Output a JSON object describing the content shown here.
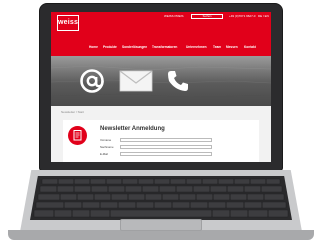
{
  "site": {
    "logo_text": "weiss",
    "top_links": [
      "WEISS PREIS",
      "+49 (0)7071 9627-0",
      "DE / EN"
    ],
    "search_label": "Suchen"
  },
  "nav": {
    "items": [
      "Home",
      "Produkte",
      "Sonderlösungen",
      "Transformatoren",
      "Unternehmen",
      "Team",
      "Messen",
      "Kontakt"
    ]
  },
  "hero": {
    "icons": [
      "at-sign-icon",
      "envelope-icon",
      "telephone-icon"
    ]
  },
  "breadcrumb": "Newsletter / Start",
  "newsletter": {
    "title": "Newsletter Anmeldung",
    "fields": [
      {
        "label": "Vorname",
        "value": ""
      },
      {
        "label": "Nachname",
        "value": ""
      },
      {
        "label": "E-Mail",
        "value": ""
      }
    ]
  },
  "colors": {
    "brand_red": "#e1001a",
    "hero_gray": "#5b5b5b",
    "laptop_body": "#c9cacc"
  }
}
